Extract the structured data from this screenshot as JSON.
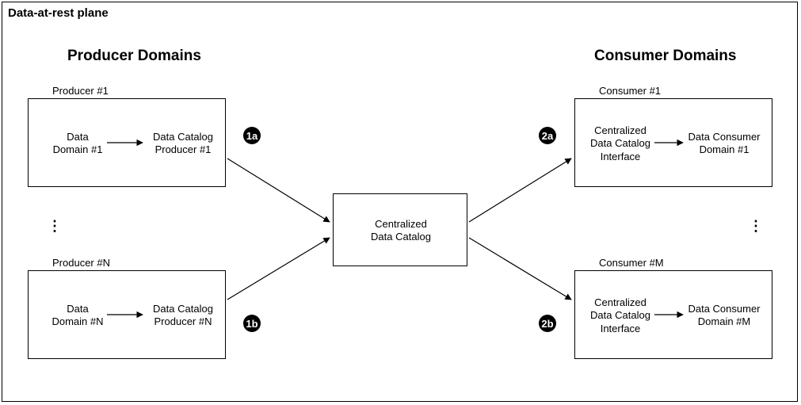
{
  "plane_title": "Data-at-rest plane",
  "headings": {
    "producers": "Producer Domains",
    "consumers": "Consumer Domains"
  },
  "producer1": {
    "title": "Producer #1",
    "data_domain": "Data\nDomain #1",
    "catalog_producer": "Data Catalog\nProducer #1"
  },
  "producerN": {
    "title": "Producer #N",
    "data_domain": "Data\nDomain #N",
    "catalog_producer": "Data Catalog\nProducer #N"
  },
  "consumer1": {
    "title": "Consumer #1",
    "interface": "Centralized\nData Catalog\nInterface",
    "consumer_domain": "Data Consumer\nDomain #1"
  },
  "consumerM": {
    "title": "Consumer #M",
    "interface": "Centralized\nData Catalog\nInterface",
    "consumer_domain": "Data Consumer\nDomain #M"
  },
  "central": "Centralized\nData Catalog",
  "badges": {
    "b1a": "1a",
    "b1b": "1b",
    "b2a": "2a",
    "b2b": "2b"
  },
  "ellipsis": "⋮"
}
